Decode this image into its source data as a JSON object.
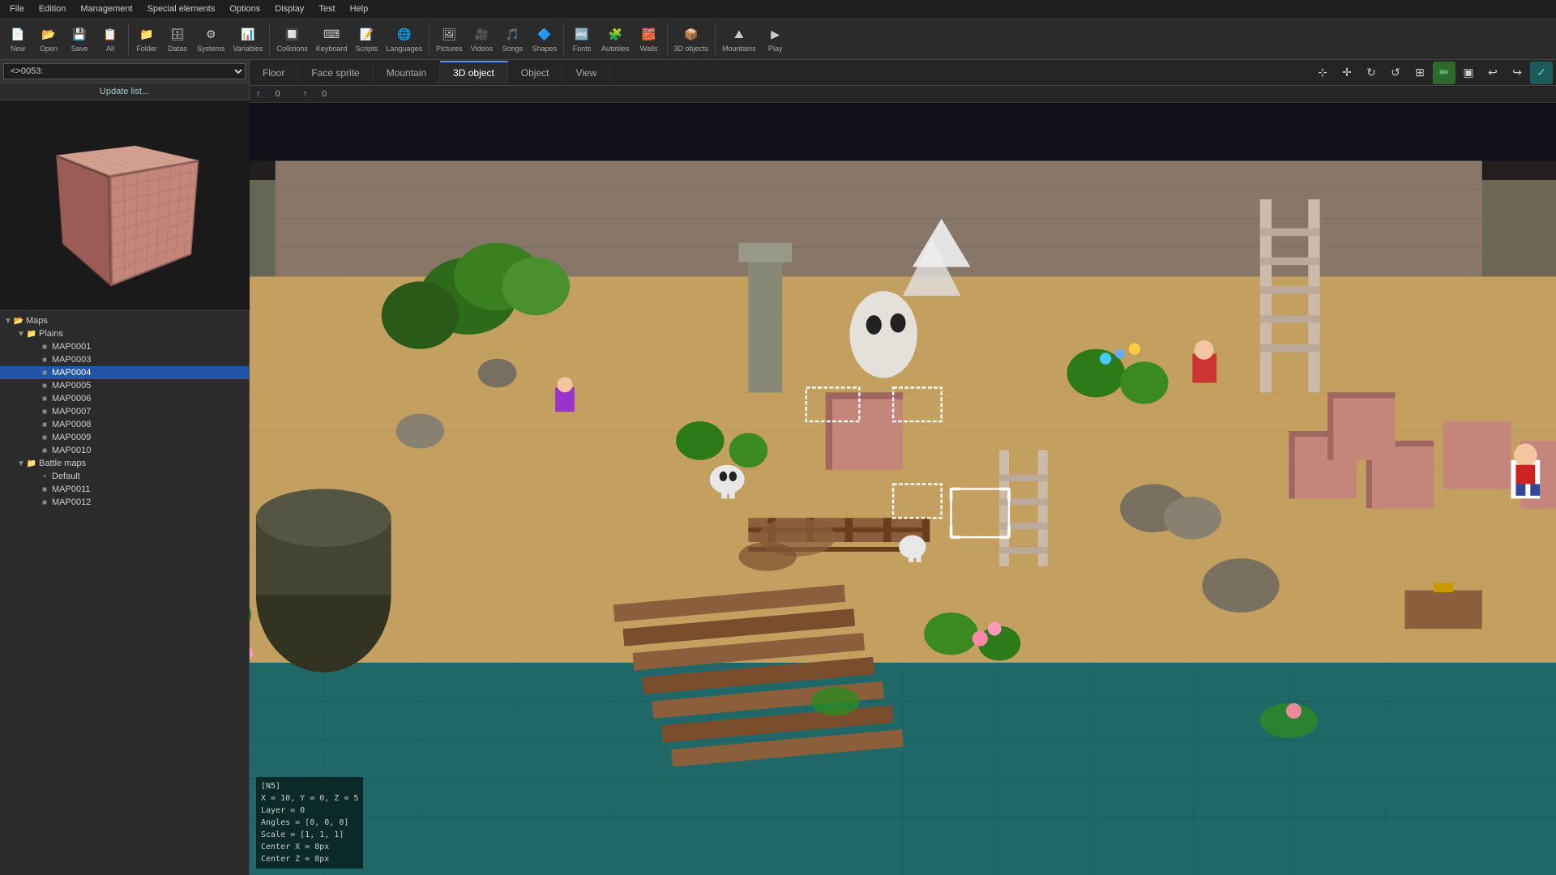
{
  "menubar": {
    "items": [
      "File",
      "Edition",
      "Management",
      "Special elements",
      "Options",
      "Display",
      "Test",
      "Help"
    ]
  },
  "toolbar": {
    "items": [
      {
        "id": "new",
        "label": "New",
        "icon": "📄"
      },
      {
        "id": "open",
        "label": "Open",
        "icon": "📂"
      },
      {
        "id": "save",
        "label": "Save",
        "icon": "💾"
      },
      {
        "id": "all",
        "label": "All",
        "icon": "📋"
      },
      {
        "id": "folder",
        "label": "Folder",
        "icon": "📁"
      },
      {
        "id": "datas",
        "label": "Datas",
        "icon": "🗄"
      },
      {
        "id": "systems",
        "label": "Systems",
        "icon": "⚙"
      },
      {
        "id": "variables",
        "label": "Variables",
        "icon": "📊"
      },
      {
        "id": "collisions",
        "label": "Collisions",
        "icon": "🔲"
      },
      {
        "id": "keyboard",
        "label": "Keyboard",
        "icon": "⌨"
      },
      {
        "id": "scripts",
        "label": "Scripts",
        "icon": "📝"
      },
      {
        "id": "languages",
        "label": "Languages",
        "icon": "🌐"
      },
      {
        "id": "pictures",
        "label": "Pictures",
        "icon": "🖼"
      },
      {
        "id": "videos",
        "label": "Videos",
        "icon": "🎥"
      },
      {
        "id": "songs",
        "label": "Songs",
        "icon": "🎵"
      },
      {
        "id": "shapes",
        "label": "Shapes",
        "icon": "🔷"
      },
      {
        "id": "fonts",
        "label": "Fonts",
        "icon": "🔤"
      },
      {
        "id": "autotiles",
        "label": "Autotiles",
        "icon": "🧩"
      },
      {
        "id": "walls",
        "label": "Walls",
        "icon": "🧱"
      },
      {
        "id": "3dobjects",
        "label": "3D objects",
        "icon": "📦"
      },
      {
        "id": "mountains",
        "label": "Mountains",
        "icon": "⛰"
      },
      {
        "id": "play",
        "label": "Play",
        "icon": "▶"
      }
    ]
  },
  "left_panel": {
    "map_selector": {
      "value": "<>0053:",
      "placeholder": "<>0053:"
    },
    "update_list_label": "Update list...",
    "tree": {
      "items": [
        {
          "id": "maps-root",
          "label": "Maps",
          "type": "root",
          "indent": 0,
          "expanded": true
        },
        {
          "id": "plains",
          "label": "Plains",
          "type": "folder",
          "indent": 1,
          "expanded": true
        },
        {
          "id": "map0001",
          "label": "MAP0001",
          "type": "map",
          "indent": 2
        },
        {
          "id": "map0003",
          "label": "MAP0003",
          "type": "map",
          "indent": 2
        },
        {
          "id": "map0004",
          "label": "MAP0004",
          "type": "map",
          "indent": 2,
          "selected": true
        },
        {
          "id": "map0005",
          "label": "MAP0005",
          "type": "map",
          "indent": 2
        },
        {
          "id": "map0006",
          "label": "MAP0006",
          "type": "map",
          "indent": 2
        },
        {
          "id": "map0007",
          "label": "MAP0007",
          "type": "map",
          "indent": 2
        },
        {
          "id": "map0008",
          "label": "MAP0008",
          "type": "map",
          "indent": 2
        },
        {
          "id": "map0009",
          "label": "MAP0009",
          "type": "map",
          "indent": 2
        },
        {
          "id": "map0010",
          "label": "MAP0010",
          "type": "map",
          "indent": 2
        },
        {
          "id": "battle-maps",
          "label": "Battle maps",
          "type": "folder",
          "indent": 1,
          "expanded": true
        },
        {
          "id": "default",
          "label": "Default",
          "type": "map-special",
          "indent": 2
        },
        {
          "id": "map0011",
          "label": "MAP0011",
          "type": "map",
          "indent": 2
        },
        {
          "id": "map0012",
          "label": "MAP0012",
          "type": "map",
          "indent": 2
        }
      ]
    }
  },
  "editor": {
    "tabs": [
      {
        "id": "floor",
        "label": "Floor"
      },
      {
        "id": "face-sprite",
        "label": "Face sprite"
      },
      {
        "id": "mountain",
        "label": "Mountain"
      },
      {
        "id": "3d-object",
        "label": "3D object",
        "active": true
      },
      {
        "id": "object",
        "label": "Object"
      },
      {
        "id": "view",
        "label": "View"
      }
    ],
    "coords": {
      "x": "0",
      "y": "0"
    },
    "tool_buttons": [
      {
        "id": "select",
        "icon": "⊹",
        "active": false
      },
      {
        "id": "translate",
        "icon": "✛",
        "active": false
      },
      {
        "id": "rotate-x",
        "icon": "↻",
        "active": false
      },
      {
        "id": "rotate-y",
        "icon": "↺",
        "active": false
      },
      {
        "id": "scale",
        "icon": "⊞",
        "active": false
      },
      {
        "id": "draw",
        "icon": "✏",
        "active": true,
        "color": "green"
      },
      {
        "id": "fill",
        "icon": "▣",
        "active": false
      },
      {
        "id": "undo",
        "icon": "↩",
        "active": false
      },
      {
        "id": "redo",
        "icon": "↪",
        "active": false
      },
      {
        "id": "confirm",
        "icon": "✓",
        "active": true,
        "color": "teal"
      }
    ],
    "info_overlay": {
      "line1": "[N5]",
      "line2": "X = 10, Y = 0, Z = 5",
      "line3": "Layer = 0",
      "line4": "Angles = [0, 0, 0]",
      "line5": "Scale = [1, 1, 1]",
      "line6": "Center X = 8px",
      "line7": "Center Z = 8px"
    }
  }
}
